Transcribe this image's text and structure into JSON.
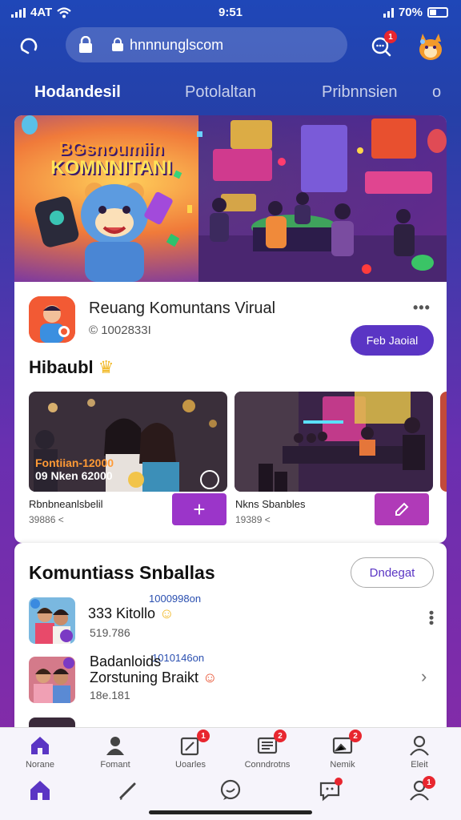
{
  "status_bar": {
    "carrier": "4AT",
    "time": "9:51",
    "battery": "70%"
  },
  "header": {
    "url": "hnnnunglscom"
  },
  "tabs": [
    {
      "label": "Hodandesil",
      "active": true
    },
    {
      "label": "Potolaltan",
      "active": false
    },
    {
      "label": "Pribnnsien",
      "active": false
    },
    {
      "label": "o",
      "active": false
    }
  ],
  "hero": {
    "title_line1": "BGsnoumiin",
    "title_line2": "KOMNNITANI"
  },
  "community": {
    "name": "Reuang Komuntans Virual",
    "count": "© 1002833I",
    "join_label": "Feb Jaoial"
  },
  "gallery": {
    "title": "Hibaubl",
    "cards": [
      {
        "overlay_line1": "Fontiian-12000",
        "overlay_line2": "09 Nken 62000",
        "title": "Rbnbneanlsbelil",
        "sub": "39886 <"
      },
      {
        "title": "Nkns Sbanbles",
        "sub": "19389 <"
      }
    ]
  },
  "communities_section": {
    "title": "Komuntiass Snballas",
    "button_label": "Dndegat",
    "items": [
      {
        "meta": "1000998on",
        "name": "333 Kitollo",
        "count": "519.786"
      },
      {
        "meta": "1010146on",
        "name": "Badanloids",
        "name_line2": "Zorstuning Braikt",
        "count": "18e.181"
      }
    ]
  },
  "bottom_nav": {
    "items": [
      {
        "label": "Norane",
        "icon": "home-icon"
      },
      {
        "label": "Fomant",
        "icon": "person-icon"
      },
      {
        "label": "Uoarles",
        "icon": "edit-icon",
        "badge": "1"
      },
      {
        "label": "Conndrotns",
        "icon": "list-icon",
        "badge": "2"
      },
      {
        "label": "Nemik",
        "icon": "image-icon",
        "badge": "2"
      },
      {
        "label": "Eleit",
        "icon": "profile-icon"
      }
    ],
    "badge_top": "1",
    "badge_profile": "1"
  },
  "colors": {
    "primary": "#5a35c4",
    "accent": "#9b35c9",
    "badge": "#e8262f"
  }
}
